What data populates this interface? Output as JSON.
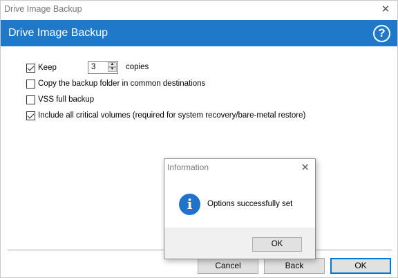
{
  "window": {
    "title": "Drive Image Backup"
  },
  "banner": {
    "heading": "Drive Image Backup",
    "help_glyph": "?"
  },
  "options": {
    "keep": {
      "label": "Keep",
      "checked": true,
      "copies_value": "3",
      "copies_suffix": "copies"
    },
    "copy_backup_folder": {
      "label": "Copy the backup folder in common destinations",
      "checked": false
    },
    "vss_full_backup": {
      "label": "VSS full backup",
      "checked": false
    },
    "include_critical_volumes": {
      "label": "Include all critical volumes (required for system recovery/bare-metal restore)",
      "checked": true
    }
  },
  "buttons": {
    "cancel": "Cancel",
    "back": "Back",
    "ok": "OK"
  },
  "dialog": {
    "title": "Information",
    "message": "Options successfully set",
    "ok": "OK",
    "icon": "info-icon"
  },
  "colors": {
    "accent": "#1f78c8",
    "focus_border": "#0078d7"
  }
}
